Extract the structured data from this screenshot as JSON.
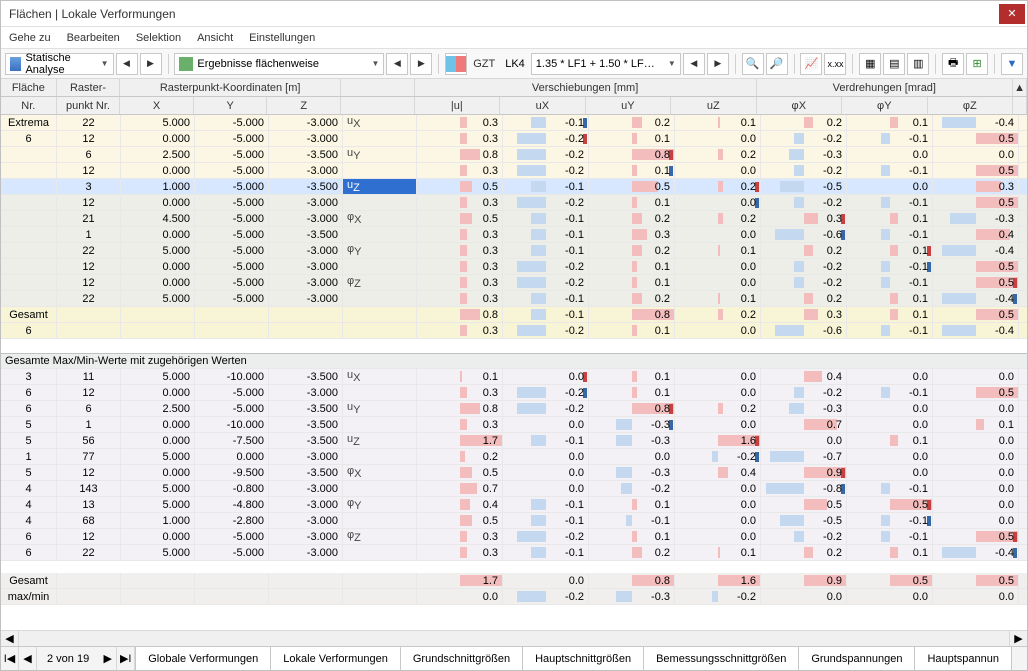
{
  "title": "Flächen | Lokale Verformungen",
  "menu": [
    "Gehe zu",
    "Bearbeiten",
    "Selektion",
    "Ansicht",
    "Einstellungen"
  ],
  "toolbar": {
    "analysis": "Statische Analyse",
    "results": "Ergebnisse flächenweise",
    "gzt": "GZT",
    "lk": "LK4",
    "combo": "1.35 * LF1 + 1.50 * LF…"
  },
  "headers": {
    "group_coord": "Rasterpunkt-Koordinaten [m]",
    "group_disp": "Verschiebungen [mm]",
    "group_rot": "Verdrehungen [mrad]",
    "flaeche": "Fläche Nr.",
    "raster": "Raster-punkt Nr.",
    "x": "X",
    "y": "Y",
    "z": "Z",
    "u": "|u|",
    "ux": "u",
    "ux_sub": "X",
    "uy": "u",
    "uy_sub": "Y",
    "uz": "u",
    "uz_sub": "Z",
    "px": "φ",
    "px_sub": "X",
    "py": "φ",
    "py_sub": "Y",
    "pz": "φ",
    "pz_sub": "Z"
  },
  "labels": {
    "extrema": "Extrema",
    "six": "6",
    "gesamt": "Gesamt",
    "maxminhdr": "Gesamte Max/Min-Werte mit zugehörigen Werten",
    "maxmin": "max/min"
  },
  "comps": [
    "uX",
    "uY",
    "uZ",
    "φX",
    "φY",
    "φZ"
  ],
  "rows_extrema": [
    {
      "f": "",
      "r": 22,
      "x": "5.000",
      "y": "-5.000",
      "z": "-3.000",
      "c": "uX",
      "u": "0.3",
      "ux": "-0.1",
      "uy": "0.2",
      "uz": "0.1",
      "px": "0.2",
      "py": "0.1",
      "pz": "-0.4",
      "dux": "blue"
    },
    {
      "f": "",
      "r": 12,
      "x": "0.000",
      "y": "-5.000",
      "z": "-3.000",
      "c": "",
      "u": "0.3",
      "ux": "-0.2",
      "uy": "0.1",
      "uz": "0.0",
      "px": "-0.2",
      "py": "-0.1",
      "pz": "0.5",
      "dux": "red"
    },
    {
      "f": "",
      "r": 6,
      "x": "2.500",
      "y": "-5.000",
      "z": "-3.500",
      "c": "uY",
      "u": "0.8",
      "ux": "-0.2",
      "uy": "0.8",
      "uz": "0.2",
      "px": "-0.3",
      "py": "0.0",
      "pz": "0.0",
      "duy": "red"
    },
    {
      "f": "",
      "r": 12,
      "x": "0.000",
      "y": "-5.000",
      "z": "-3.000",
      "c": "",
      "u": "0.3",
      "ux": "-0.2",
      "uy": "0.1",
      "uz": "0.0",
      "px": "-0.2",
      "py": "-0.1",
      "pz": "0.5",
      "duy": "blue"
    },
    {
      "f": "",
      "r": 3,
      "x": "1.000",
      "y": "-5.000",
      "z": "-3.500",
      "c": "uZ",
      "u": "0.5",
      "ux": "-0.1",
      "uy": "0.5",
      "uz": "0.2",
      "px": "-0.5",
      "py": "0.0",
      "pz": "0.3",
      "sel": true,
      "duz": "red"
    },
    {
      "f": "",
      "r": 12,
      "x": "0.000",
      "y": "-5.000",
      "z": "-3.000",
      "c": "",
      "u": "0.3",
      "ux": "-0.2",
      "uy": "0.1",
      "uz": "0.0",
      "px": "-0.2",
      "py": "-0.1",
      "pz": "0.5",
      "duz": "blue"
    },
    {
      "f": "",
      "r": 21,
      "x": "4.500",
      "y": "-5.000",
      "z": "-3.000",
      "c": "φX",
      "u": "0.5",
      "ux": "-0.1",
      "uy": "0.2",
      "uz": "0.2",
      "px": "0.3",
      "py": "0.1",
      "pz": "-0.3",
      "dpx": "red"
    },
    {
      "f": "",
      "r": 1,
      "x": "0.000",
      "y": "-5.000",
      "z": "-3.500",
      "c": "",
      "u": "0.3",
      "ux": "-0.1",
      "uy": "0.3",
      "uz": "0.0",
      "px": "-0.6",
      "py": "-0.1",
      "pz": "0.4",
      "dpx": "blue"
    },
    {
      "f": "",
      "r": 22,
      "x": "5.000",
      "y": "-5.000",
      "z": "-3.000",
      "c": "φY",
      "u": "0.3",
      "ux": "-0.1",
      "uy": "0.2",
      "uz": "0.1",
      "px": "0.2",
      "py": "0.1",
      "pz": "-0.4",
      "dpy": "red"
    },
    {
      "f": "",
      "r": 12,
      "x": "0.000",
      "y": "-5.000",
      "z": "-3.000",
      "c": "",
      "u": "0.3",
      "ux": "-0.2",
      "uy": "0.1",
      "uz": "0.0",
      "px": "-0.2",
      "py": "-0.1",
      "pz": "0.5",
      "dpy": "blue"
    },
    {
      "f": "",
      "r": 12,
      "x": "0.000",
      "y": "-5.000",
      "z": "-3.000",
      "c": "φZ",
      "u": "0.3",
      "ux": "-0.2",
      "uy": "0.1",
      "uz": "0.0",
      "px": "-0.2",
      "py": "-0.1",
      "pz": "0.5",
      "dpz": "red"
    },
    {
      "f": "",
      "r": 22,
      "x": "5.000",
      "y": "-5.000",
      "z": "-3.000",
      "c": "",
      "u": "0.3",
      "ux": "-0.1",
      "uy": "0.2",
      "uz": "0.1",
      "px": "0.2",
      "py": "0.1",
      "pz": "-0.4",
      "dpz": "blue"
    }
  ],
  "rows_gesamt": [
    {
      "f": "Gesamt",
      "u": "0.8",
      "ux": "-0.1",
      "uy": "0.8",
      "uz": "0.2",
      "px": "0.3",
      "py": "0.1",
      "pz": "0.5"
    },
    {
      "f": "6",
      "u": "0.3",
      "ux": "-0.2",
      "uy": "0.1",
      "uz": "0.0",
      "px": "-0.6",
      "py": "-0.1",
      "pz": "-0.4"
    }
  ],
  "rows_maxmin": [
    {
      "f": 3,
      "r": 11,
      "x": "5.000",
      "y": "-10.000",
      "z": "-3.500",
      "c": "uX",
      "u": "0.1",
      "ux": "0.0",
      "uy": "0.1",
      "uz": "0.0",
      "px": "0.4",
      "py": "0.0",
      "pz": "0.0",
      "dux": "red"
    },
    {
      "f": 6,
      "r": 12,
      "x": "0.000",
      "y": "-5.000",
      "z": "-3.000",
      "c": "",
      "u": "0.3",
      "ux": "-0.2",
      "uy": "0.1",
      "uz": "0.0",
      "px": "-0.2",
      "py": "-0.1",
      "pz": "0.5",
      "dux": "blue"
    },
    {
      "f": 6,
      "r": 6,
      "x": "2.500",
      "y": "-5.000",
      "z": "-3.500",
      "c": "uY",
      "u": "0.8",
      "ux": "-0.2",
      "uy": "0.8",
      "uz": "0.2",
      "px": "-0.3",
      "py": "0.0",
      "pz": "0.0",
      "duy": "red"
    },
    {
      "f": 5,
      "r": 1,
      "x": "0.000",
      "y": "-10.000",
      "z": "-3.500",
      "c": "",
      "u": "0.3",
      "ux": "0.0",
      "uy": "-0.3",
      "uz": "0.0",
      "px": "0.7",
      "py": "0.0",
      "pz": "0.1",
      "duy": "blue"
    },
    {
      "f": 5,
      "r": 56,
      "x": "0.000",
      "y": "-7.500",
      "z": "-3.500",
      "c": "uZ",
      "u": "1.7",
      "ux": "-0.1",
      "uy": "-0.3",
      "uz": "1.6",
      "px": "0.0",
      "py": "0.1",
      "pz": "0.0",
      "duz": "red"
    },
    {
      "f": 1,
      "r": 77,
      "x": "5.000",
      "y": "0.000",
      "z": "-3.000",
      "c": "",
      "u": "0.2",
      "ux": "0.0",
      "uy": "0.0",
      "uz": "-0.2",
      "px": "-0.7",
      "py": "0.0",
      "pz": "0.0",
      "duz": "blue"
    },
    {
      "f": 5,
      "r": 12,
      "x": "0.000",
      "y": "-9.500",
      "z": "-3.500",
      "c": "φX",
      "u": "0.5",
      "ux": "0.0",
      "uy": "-0.3",
      "uz": "0.4",
      "px": "0.9",
      "py": "0.0",
      "pz": "0.0",
      "dpx": "red"
    },
    {
      "f": 4,
      "r": 143,
      "x": "5.000",
      "y": "-0.800",
      "z": "-3.000",
      "c": "",
      "u": "0.7",
      "ux": "0.0",
      "uy": "-0.2",
      "uz": "0.0",
      "px": "-0.8",
      "py": "-0.1",
      "pz": "0.0",
      "dpx": "blue"
    },
    {
      "f": 4,
      "r": 13,
      "x": "5.000",
      "y": "-4.800",
      "z": "-3.000",
      "c": "φY",
      "u": "0.4",
      "ux": "-0.1",
      "uy": "0.1",
      "uz": "0.0",
      "px": "0.5",
      "py": "0.5",
      "pz": "0.0",
      "dpy": "red"
    },
    {
      "f": 4,
      "r": 68,
      "x": "1.000",
      "y": "-2.800",
      "z": "-3.000",
      "c": "",
      "u": "0.5",
      "ux": "-0.1",
      "uy": "-0.1",
      "uz": "0.0",
      "px": "-0.5",
      "py": "-0.1",
      "pz": "0.0",
      "dpy": "blue"
    },
    {
      "f": 6,
      "r": 12,
      "x": "0.000",
      "y": "-5.000",
      "z": "-3.000",
      "c": "φZ",
      "u": "0.3",
      "ux": "-0.2",
      "uy": "0.1",
      "uz": "0.0",
      "px": "-0.2",
      "py": "-0.1",
      "pz": "0.5",
      "dpz": "red"
    },
    {
      "f": 6,
      "r": 22,
      "x": "5.000",
      "y": "-5.000",
      "z": "-3.000",
      "c": "",
      "u": "0.3",
      "ux": "-0.1",
      "uy": "0.2",
      "uz": "0.1",
      "px": "0.2",
      "py": "0.1",
      "pz": "-0.4",
      "dpz": "blue"
    }
  ],
  "rows_final": [
    {
      "f": "Gesamt",
      "u": "1.7",
      "ux": "0.0",
      "uy": "0.8",
      "uz": "1.6",
      "px": "0.9",
      "py": "0.5",
      "pz": "0.5"
    },
    {
      "f": "max/min",
      "u": "0.0",
      "ux": "-0.2",
      "uy": "-0.3",
      "uz": "-0.2",
      "px": "0.0",
      "py": "0.0",
      "pz": "0.0"
    }
  ],
  "footer": {
    "page": "2 von 19",
    "tabs": [
      "Globale Verformungen",
      "Lokale Verformungen",
      "Grundschnittgrößen",
      "Hauptschnittgrößen",
      "Bemessungsschnittgrößen",
      "Grundspannungen",
      "Hauptspannun"
    ]
  }
}
